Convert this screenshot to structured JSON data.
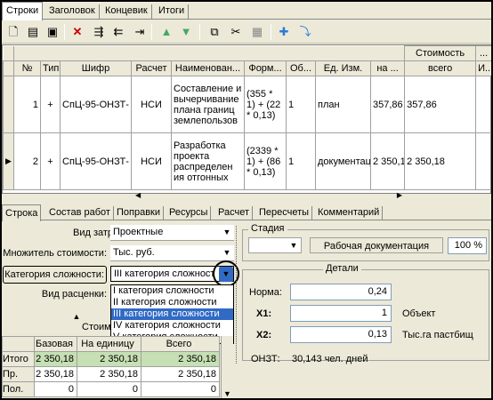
{
  "top_tabs": [
    "Строки",
    "Заголовок",
    "Концевик",
    "Итоги"
  ],
  "toolbar_icons": [
    "new-icon",
    "copy-doc-icon",
    "save-icon",
    "delete-icon",
    "indent-icon",
    "outdent-icon",
    "export-icon",
    "move-up-icon",
    "move-down-icon",
    "sep",
    "copy-icon",
    "cut-icon",
    "paste-icon",
    "add-row-icon",
    "add-subrow-icon"
  ],
  "grid": {
    "group_header": "Стоимость",
    "group_header2": "...",
    "headers": [
      "№",
      "Тип",
      "Шифр",
      "Расчет",
      "Наименован...",
      "Форм...",
      "Об...",
      "Ед. Изм.",
      "на ...",
      "всего",
      "И..."
    ],
    "rows": [
      {
        "num": "1",
        "type": "+",
        "code": "СпЦ-95-ОНЗТ-",
        "calc": "НСИ",
        "name": "Составление и вычерчивание плана границ землепользов",
        "formula": "(355 * 1) + (22 * 0,13)",
        "vol": "1",
        "unit": "план",
        "per": "357,86",
        "total": "357,86"
      },
      {
        "num": "2",
        "type": "+",
        "code": "СпЦ-95-ОНЗТ-",
        "calc": "НСИ",
        "name": "Разработка проекта распределен ия отгонных",
        "formula": "(2339 * 1) + (86 * 0,13)",
        "vol": "1",
        "unit": "документац",
        "per": "2 350,1",
        "total": "2 350,18"
      }
    ]
  },
  "bottom_tabs": [
    "Строка",
    "Состав работ",
    "Поправки",
    "Ресурсы",
    "Расчет",
    "Пересчеты",
    "Комментарий"
  ],
  "form": {
    "cost_type_label": "Вид затрат:",
    "cost_type_value": "Проектные",
    "multiplier_label": "Множитель стоимости:",
    "multiplier_value": "Тыс. руб.",
    "category_label": "Категория сложности:",
    "category_value": "III категория сложност",
    "pricing_label": "Вид расценки:",
    "category_options": [
      "I категория сложности",
      "II категория сложности",
      "III категория сложности",
      "IV категория сложности",
      "V категория сложности"
    ],
    "selected_option": 2
  },
  "stage": {
    "legend": "Стадия",
    "value": "Рабочая документация",
    "percent": "100 %"
  },
  "details": {
    "legend": "Детали",
    "norm_label": "Норма:",
    "norm_value": "0,24",
    "x1_label": "X1:",
    "x1_value": "1",
    "x1_unit": "Объект",
    "x2_label": "X2:",
    "x2_value": "0,13",
    "x2_unit": "Тыс.га пастбищ",
    "onzt_label": "ОНЗТ:",
    "onzt_value": "30,143 чел. дней"
  },
  "cost_table": {
    "title": "Стоим",
    "headers": [
      "",
      "Базовая",
      "На единицу",
      "Всего"
    ],
    "rows": [
      [
        "Итого",
        "2 350,18",
        "2 350,18",
        "2 350,18"
      ],
      [
        "Пр.",
        "2 350,18",
        "2 350,18",
        "2 350,18"
      ],
      [
        "Пол.",
        "0",
        "0",
        "0"
      ]
    ]
  },
  "colors": {
    "selection": "#316ac5",
    "total_row": "#c6e0b4",
    "highlight_ring": "#000000"
  }
}
